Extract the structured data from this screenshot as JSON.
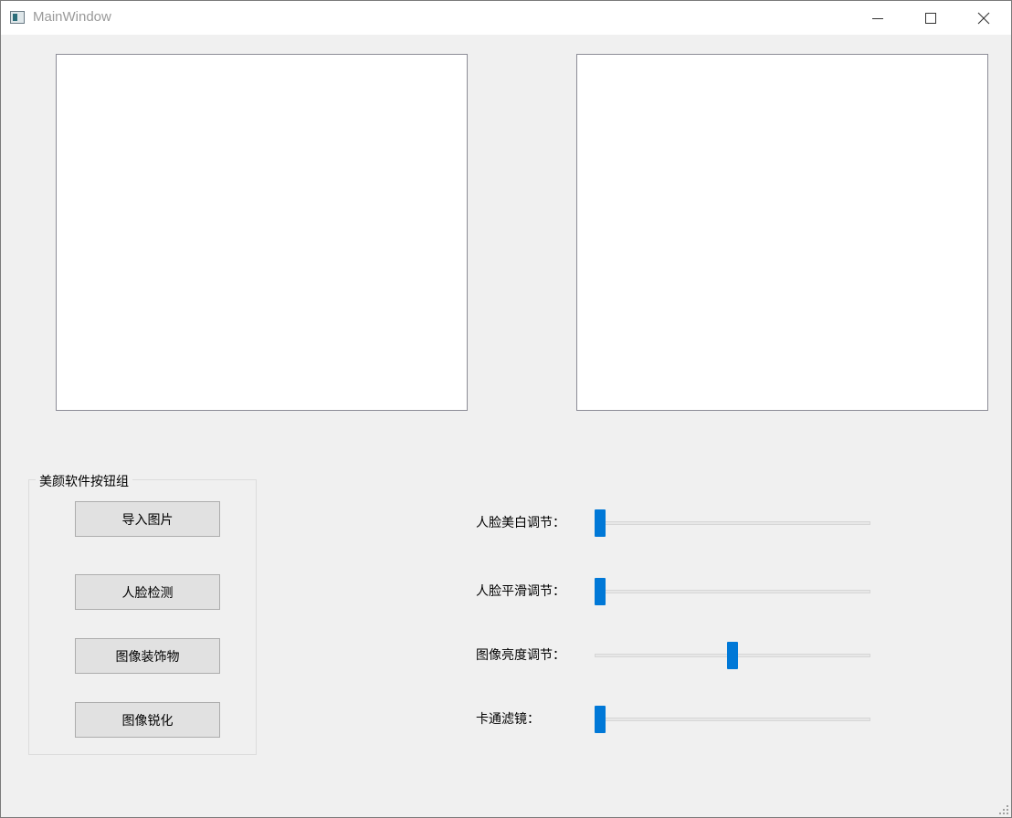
{
  "window": {
    "title": "MainWindow"
  },
  "icons": {
    "app": "app-window-icon",
    "minimize": "minimize-icon",
    "maximize": "maximize-icon",
    "close": "close-icon",
    "size_grip": "resize-grip-icon"
  },
  "group": {
    "title": "美颜软件按钮组",
    "buttons": [
      {
        "label": "导入图片"
      },
      {
        "label": "人脸检测"
      },
      {
        "label": "图像装饰物"
      },
      {
        "label": "图像锐化"
      }
    ]
  },
  "sliders": [
    {
      "label": "人脸美白调节：",
      "value_fraction": 0.0
    },
    {
      "label": "人脸平滑调节：",
      "value_fraction": 0.0
    },
    {
      "label": "图像亮度调节：",
      "value_fraction": 0.5
    },
    {
      "label": "卡通滤镜：",
      "value_fraction": 0.0
    }
  ],
  "colors": {
    "accent": "#0078d7",
    "window_bg": "#f0f0f0",
    "button_bg": "#e1e1e1"
  }
}
